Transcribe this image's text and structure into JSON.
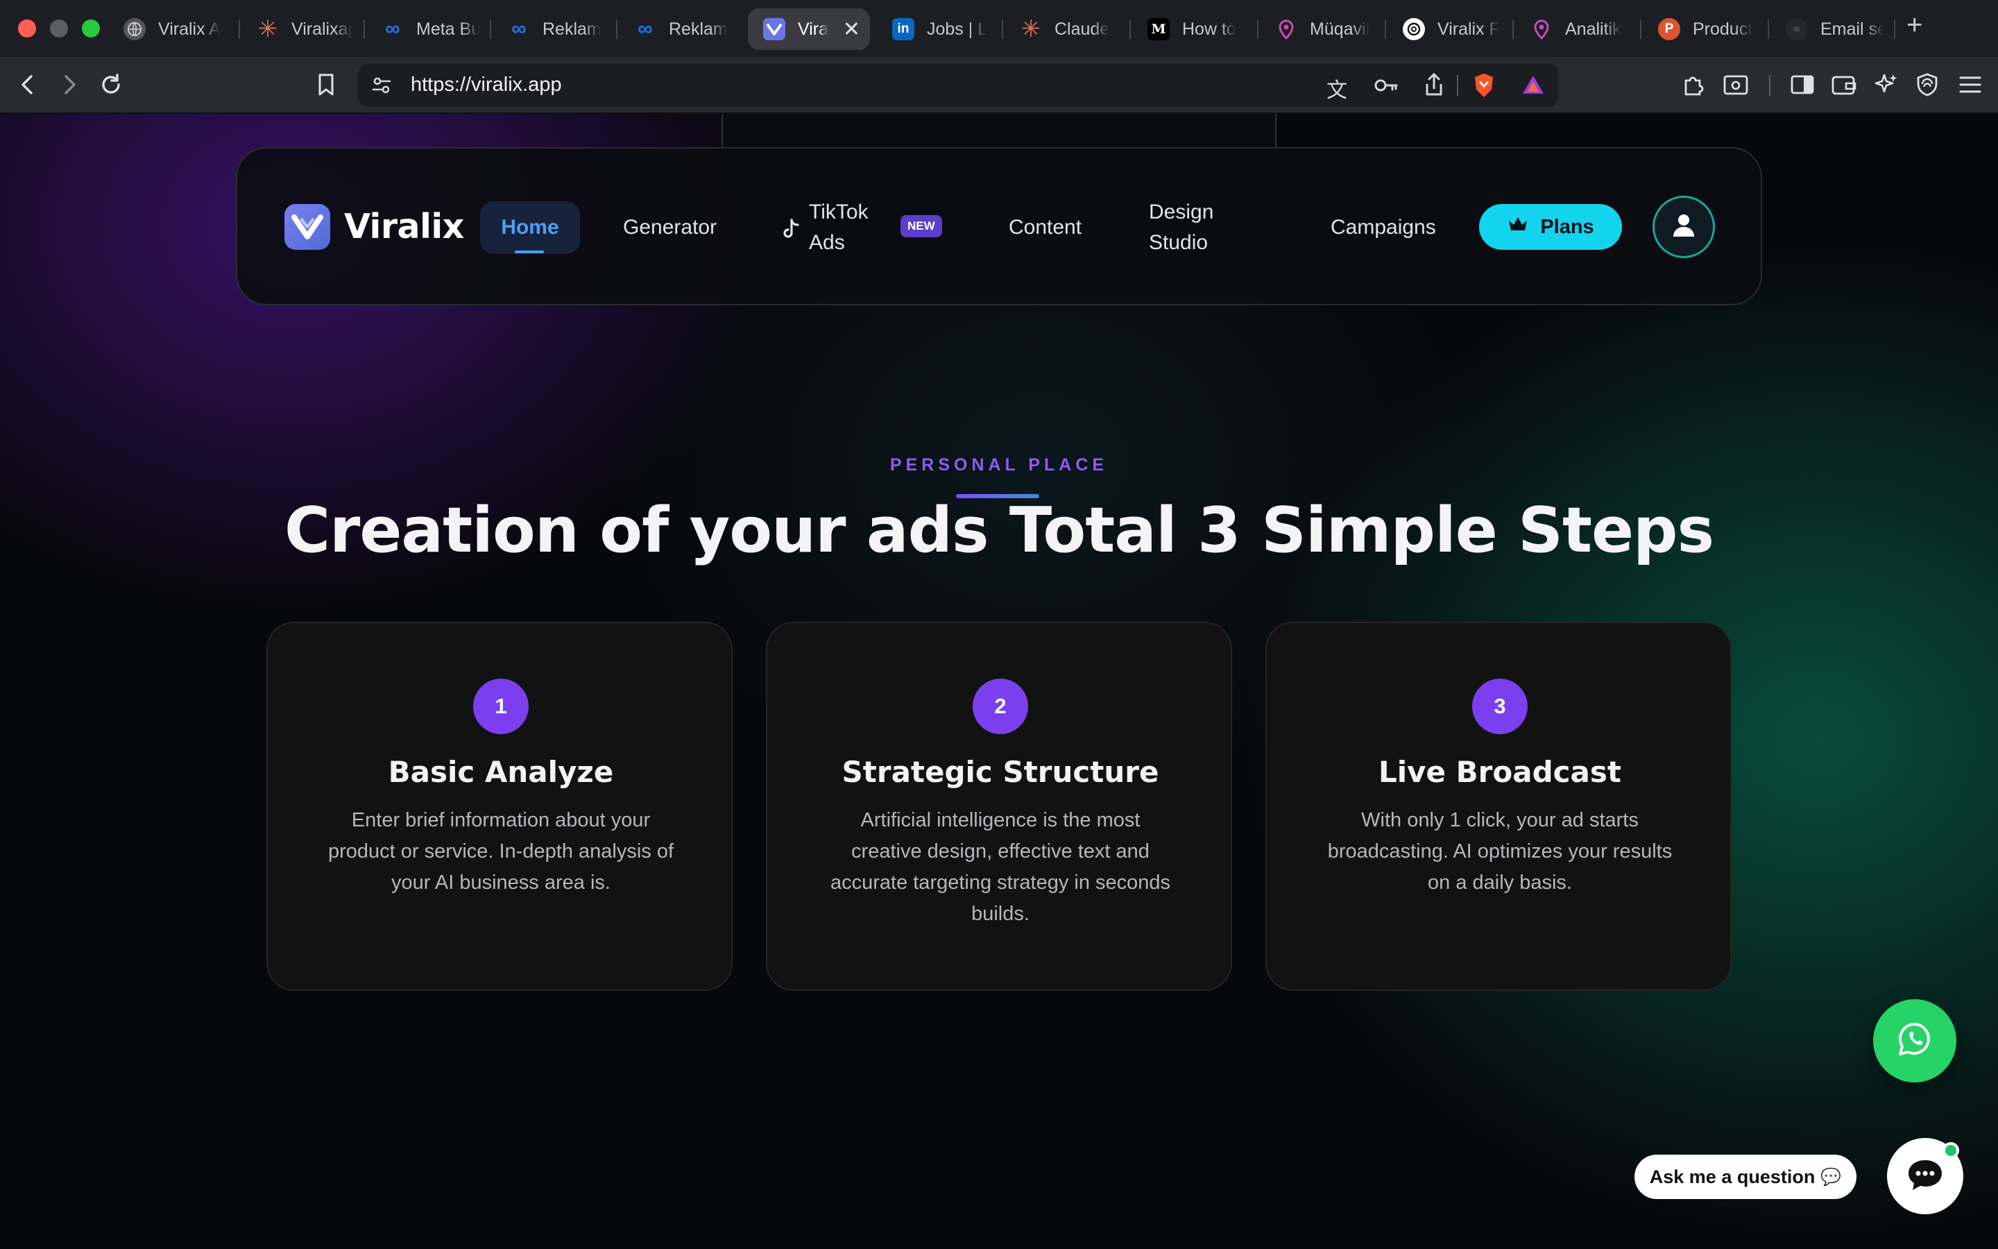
{
  "browser": {
    "tabs": [
      {
        "title": "Viralix A",
        "icon": "globe-icon",
        "color": "#5a5b60"
      },
      {
        "title": "Viralixap",
        "icon": "claude-icon",
        "color": "#d97757"
      },
      {
        "title": "Meta Bu",
        "icon": "meta-icon",
        "color": "#1877f2"
      },
      {
        "title": "Reklam",
        "icon": "meta-icon",
        "color": "#1877f2"
      },
      {
        "title": "Reklam",
        "icon": "meta-icon",
        "color": "#1877f2"
      },
      {
        "title": "Vira",
        "icon": "viralix-icon",
        "color": "#6b74e8",
        "active": true
      },
      {
        "title": "Jobs | L",
        "icon": "linkedin-icon",
        "color": "#0a66c2"
      },
      {
        "title": "Claude",
        "icon": "claude-icon",
        "color": "#d97757"
      },
      {
        "title": "How to",
        "icon": "medium-icon",
        "color": "#000000"
      },
      {
        "title": "Müqavil",
        "icon": "pin-icon",
        "color": "#c04fb6"
      },
      {
        "title": "Viralix F",
        "icon": "openai-icon",
        "color": "#ffffff"
      },
      {
        "title": "Analitik",
        "icon": "pin-icon",
        "color": "#c04fb6"
      },
      {
        "title": "Product",
        "icon": "producthunt-icon",
        "color": "#da552f"
      },
      {
        "title": "Email se",
        "icon": "github-icon",
        "color": "#24292f"
      }
    ],
    "url": "https://viralix.app"
  },
  "nav": {
    "brand": "Viralix",
    "home": "Home",
    "generator": "Generator",
    "tiktok_line1": "TikTok",
    "tiktok_line2": "Ads",
    "new_badge": "NEW",
    "content": "Content",
    "design_line1": "Design",
    "design_line2": "Studio",
    "campaigns": "Campaigns",
    "plans": "Plans"
  },
  "hero": {
    "eyebrow": "PERSONAL PLACE",
    "heading": "Creation of your ads Total 3 Simple Steps"
  },
  "steps": [
    {
      "number": "1",
      "title": "Basic Analyze",
      "description": "Enter brief information about your product or service. In-depth analysis of your AI business area is."
    },
    {
      "number": "2",
      "title": "Strategic Structure",
      "description": "Artificial intelligence is the most creative design, effective text and accurate targeting strategy in seconds builds."
    },
    {
      "number": "3",
      "title": "Live Broadcast",
      "description": "With only 1 click, your ad starts broadcasting. AI optimizes your results on a daily basis."
    }
  ],
  "widgets": {
    "ask_label": "Ask me a question"
  },
  "colors": {
    "accent_purple": "#7c3fef",
    "accent_cyan": "#12d4ec",
    "whatsapp_green": "#25d366",
    "home_blue": "#4d9ff5"
  }
}
